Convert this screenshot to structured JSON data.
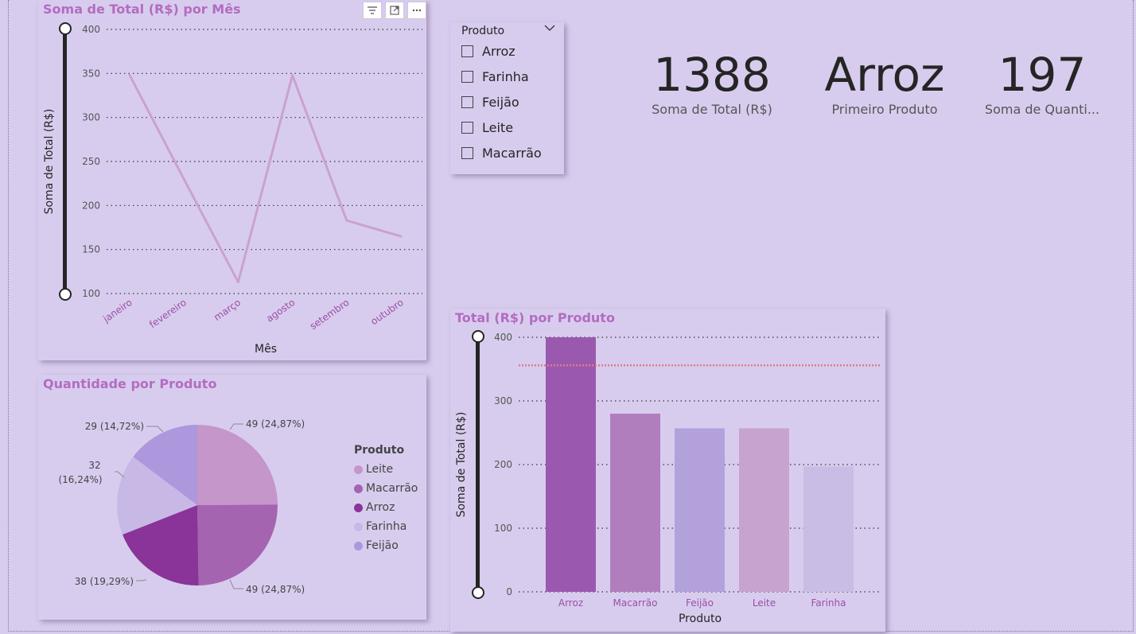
{
  "kpis": [
    {
      "value": "1388",
      "label": "Soma de Total (R$)"
    },
    {
      "value": "Arroz",
      "label": "Primeiro Produto"
    },
    {
      "value": "197",
      "label": "Soma de Quanti..."
    }
  ],
  "slicer": {
    "title": "Produto",
    "items": [
      "Arroz",
      "Farinha",
      "Feijão",
      "Leite",
      "Macarrão"
    ]
  },
  "toolbar_icons": [
    "filter-icon",
    "focus-mode-icon",
    "more-options-icon"
  ],
  "colors": {
    "background": "#d8ccee",
    "title": "#b36cc0",
    "line": "#c9a2cf",
    "reference_line": "#e07a8a"
  },
  "chart_data": [
    {
      "type": "line",
      "title": "Soma de Total (R$) por Mês",
      "xlabel": "Mês",
      "ylabel": "Soma de Total (R$)",
      "ylim": [
        100,
        400
      ],
      "yticks": [
        "400",
        "350",
        "300",
        "250",
        "200",
        "150",
        "100"
      ],
      "categories": [
        "janeiro",
        "fevereiro",
        "março",
        "agosto",
        "setembro",
        "outubro"
      ],
      "values": [
        348,
        230,
        113,
        348,
        183,
        165
      ],
      "grid": true
    },
    {
      "type": "pie",
      "title": "Quantidade por Produto",
      "legend_title": "Produto",
      "legend_position": "right",
      "slices": [
        {
          "name": "Leite",
          "value": 49,
          "label": "49 (24,87%)",
          "color": "#c596c9"
        },
        {
          "name": "Macarrão",
          "value": 49,
          "label": "49 (24,87%)",
          "color": "#a464b0"
        },
        {
          "name": "Arroz",
          "value": 38,
          "label": "38 (19,29%)",
          "color": "#8a3399"
        },
        {
          "name": "Farinha",
          "value": 32,
          "label_line1": "32",
          "label_line2": "(16,24%)",
          "color": "#c8b8e6"
        },
        {
          "name": "Feijão",
          "value": 29,
          "label": "29 (14,72%)",
          "color": "#ad97dd"
        }
      ]
    },
    {
      "type": "bar",
      "title": "Total (R$) por Produto",
      "xlabel": "Produto",
      "ylabel": "Soma de Total (R$)",
      "ylim": [
        0,
        400
      ],
      "yticks": [
        "400",
        "300",
        "200",
        "100",
        "0"
      ],
      "categories": [
        "Arroz",
        "Macarrão",
        "Feijão",
        "Leite",
        "Farinha"
      ],
      "values": [
        400,
        280,
        257,
        257,
        197
      ],
      "colors": [
        "#9a59ae",
        "#b07ebd",
        "#b3a1dc",
        "#c7a4cf",
        "#c9bde6"
      ],
      "reference_line": 356,
      "grid": true
    }
  ]
}
